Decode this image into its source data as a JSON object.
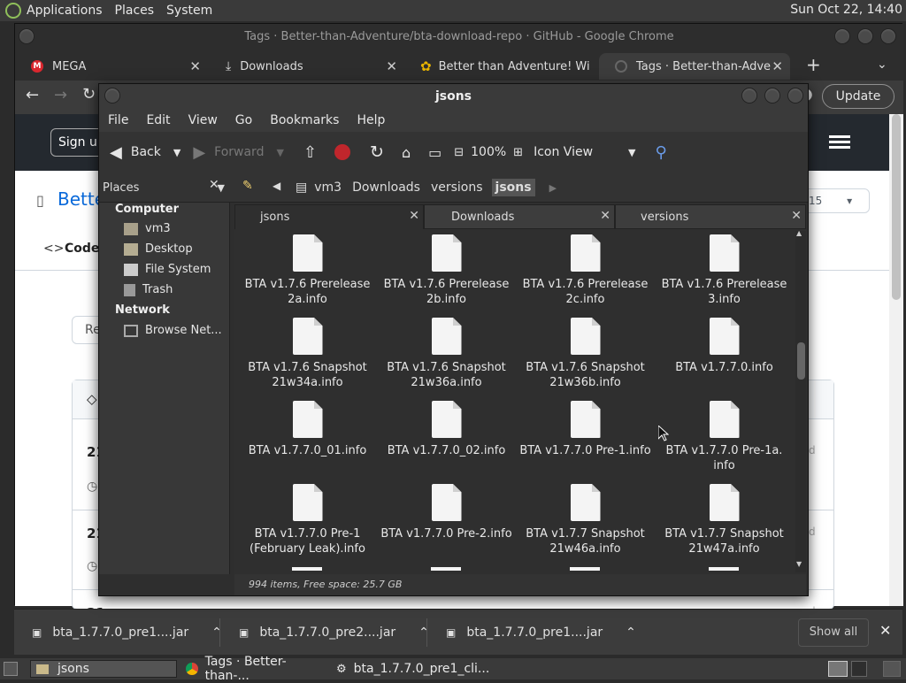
{
  "top_panel": {
    "applications": "Applications",
    "places": "Places",
    "system": "System",
    "clock": "Sun Oct 22, 14:40"
  },
  "chrome": {
    "title": "Tags · Better-than-Adventure/bta-download-repo · GitHub - Google Chrome",
    "tabs": [
      {
        "label": "MEGA"
      },
      {
        "label": "Downloads"
      },
      {
        "label": "Better than Adventure! Wi"
      },
      {
        "label": "Tags · Better-than-Advent"
      }
    ],
    "new_tab": "+",
    "update_label": "Update",
    "page_fragments": {
      "sign_up": "Sign up",
      "repo": "Bette",
      "code_tab": "Code",
      "re_btn": "Re",
      "row_a": "21",
      "row_b": "21",
      "row_c": "21",
      "count": "15",
      "badge_d": "d"
    }
  },
  "downloads": [
    {
      "name": "bta_1.7.7.0_pre1....jar"
    },
    {
      "name": "bta_1.7.7.0_pre2....jar"
    },
    {
      "name": "bta_1.7.7.0_pre1....jar"
    }
  ],
  "downloads_show_all": "Show all",
  "bottom_panel": [
    {
      "label": "jsons"
    },
    {
      "label": "Tags · Better-than-..."
    },
    {
      "label": "bta_1.7.7.0_pre1_cli..."
    }
  ],
  "nautilus": {
    "title": "jsons",
    "menu": [
      "File",
      "Edit",
      "View",
      "Go",
      "Bookmarks",
      "Help"
    ],
    "toolbar": {
      "back": "Back",
      "forward": "Forward",
      "zoom": "100%",
      "view_mode": "Icon View"
    },
    "sidebar_selector": "Places",
    "breadcrumb": [
      "vm3",
      "Downloads",
      "versions",
      "jsons"
    ],
    "sidebar": {
      "computer_header": "Computer",
      "computer_items": [
        "vm3",
        "Desktop",
        "File System",
        "Trash"
      ],
      "network_header": "Network",
      "network_items": [
        "Browse Net..."
      ]
    },
    "tabs": [
      {
        "label": "jsons"
      },
      {
        "label": "Downloads"
      },
      {
        "label": "versions"
      }
    ],
    "files": [
      [
        "BTA v1.7.6 Prerelease",
        "2a.info"
      ],
      [
        "BTA v1.7.6 Prerelease",
        "2b.info"
      ],
      [
        "BTA v1.7.6 Prerelease",
        "2c.info"
      ],
      [
        "BTA v1.7.6 Prerelease",
        "3.info"
      ],
      [
        "BTA v1.7.6 Snapshot",
        "21w34a.info"
      ],
      [
        "BTA v1.7.6 Snapshot",
        "21w36a.info"
      ],
      [
        "BTA v1.7.6 Snapshot",
        "21w36b.info"
      ],
      [
        "BTA v1.7.7.0.info",
        ""
      ],
      [
        "BTA v1.7.7.0_01.info",
        ""
      ],
      [
        "BTA v1.7.7.0_02.info",
        ""
      ],
      [
        "BTA v1.7.7.0 Pre-1.info",
        ""
      ],
      [
        "BTA v1.7.7.0 Pre-1a.",
        "info"
      ],
      [
        "BTA v1.7.7.0 Pre-1",
        "(February Leak).info"
      ],
      [
        "BTA v1.7.7.0 Pre-2.info",
        ""
      ],
      [
        "BTA v1.7.7 Snapshot",
        "21w46a.info"
      ],
      [
        "BTA v1.7.7 Snapshot",
        "21w47a.info"
      ]
    ],
    "status": "994 items, Free space: 25.7 GB"
  }
}
